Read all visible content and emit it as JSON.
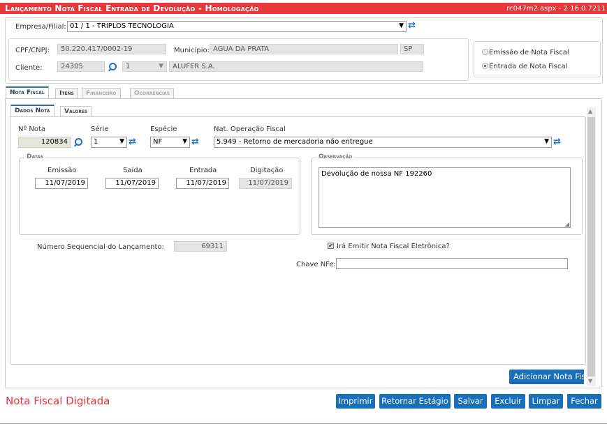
{
  "header": {
    "title": "Lançamento Nota Fiscal Entrada de Devolução  - Homologação",
    "version": "rc047m2.aspx - 2.16.0.7211"
  },
  "empresa": {
    "label": "Empresa/Filial:",
    "value": "01 / 1 - TRIPLOS TECNOLOGIA"
  },
  "cliente_info": {
    "cpf_label": "CPF/CNPJ:",
    "cpf_value": "50.220.417/0002-19",
    "municipio_label": "Município:",
    "municipio_value": "AGUA DA PRATA",
    "uf_value": "SP",
    "cliente_label": "Cliente:",
    "cliente_code": "24305",
    "cliente_seq": "1",
    "cliente_name": "ALUFER S.A."
  },
  "tipo": {
    "option1": "Emissão de Nota Fiscal",
    "option2": "Entrada de Nota Fiscal",
    "selected": "Entrada de Nota Fiscal"
  },
  "tabs": [
    {
      "label": "Nota Fiscal"
    },
    {
      "label": "Itens"
    },
    {
      "label": "Financeiro"
    },
    {
      "label": "Ocorrências"
    }
  ],
  "subtabs": [
    {
      "label": "Dados Nota"
    },
    {
      "label": "Valores"
    }
  ],
  "nota": {
    "numero_label": "Nº Nota",
    "numero_value": "120834",
    "serie_label": "Série",
    "serie_value": "1",
    "especie_label": "Espécie",
    "especie_value": "NF",
    "natop_label": "Nat. Operação Fiscal",
    "natop_value": "5.949 - Retorno de mercadoria não entregue"
  },
  "datas": {
    "legend": "Datas",
    "emissao_label": "Emissão",
    "emissao_value": "11/07/2019",
    "saida_label": "Saída",
    "saida_value": "11/07/2019",
    "entrada_label": "Entrada",
    "entrada_value": "11/07/2019",
    "digitacao_label": "Digitação",
    "digitacao_value": "11/07/2019"
  },
  "observacao": {
    "legend": "Observação",
    "value": "Devolução de nossa NF 192260"
  },
  "sequencial": {
    "label": "Número Sequencial do Lançamento:",
    "value": "69311"
  },
  "nfe": {
    "checkbox_label": "Irá Emitir Nota Fiscal Eletrônica?",
    "checked": true,
    "chave_label": "Chave NFe:",
    "chave_value": ""
  },
  "buttons": {
    "adicionar": "Adicionar Nota Fisc",
    "imprimir": "Imprimir",
    "retornar": "Retornar Estágio",
    "salvar": "Salvar",
    "excluir": "Excluir",
    "limpar": "Limpar",
    "fechar": "Fechar"
  },
  "status": {
    "text": "Nota Fiscal Digitada",
    "color": "#e8373c"
  },
  "colors": {
    "accent": "#1a70b8",
    "title_bar": "#e8373c"
  }
}
